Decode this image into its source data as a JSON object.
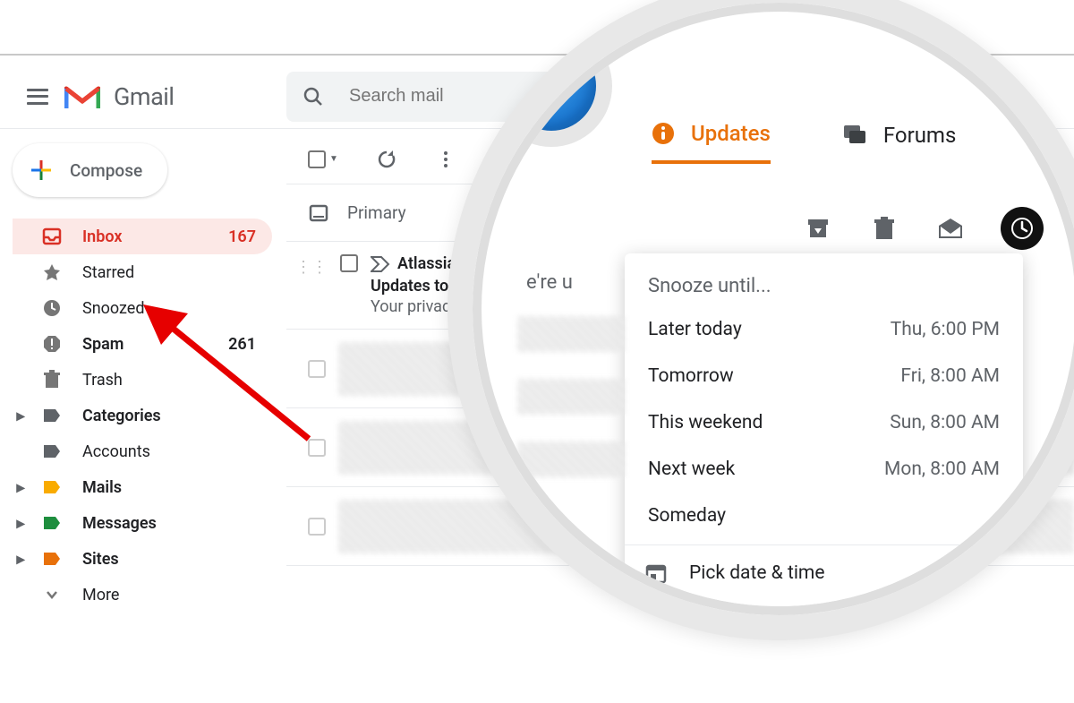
{
  "header": {
    "app_name": "Gmail",
    "search_placeholder": "Search mail"
  },
  "compose_label": "Compose",
  "sidebar": {
    "items": [
      {
        "label": "Inbox",
        "count": "167",
        "icon": "inbox",
        "active": true,
        "bold": true,
        "caret": false
      },
      {
        "label": "Starred",
        "count": "",
        "icon": "star",
        "active": false,
        "bold": false,
        "caret": false
      },
      {
        "label": "Snoozed",
        "count": "",
        "icon": "clock",
        "active": false,
        "bold": false,
        "caret": false
      },
      {
        "label": "Spam",
        "count": "261",
        "icon": "spam",
        "active": false,
        "bold": true,
        "caret": false
      },
      {
        "label": "Trash",
        "count": "",
        "icon": "trash",
        "active": false,
        "bold": false,
        "caret": false
      },
      {
        "label": "Categories",
        "count": "",
        "icon": "label-dark",
        "active": false,
        "bold": true,
        "caret": true
      },
      {
        "label": "Accounts",
        "count": "",
        "icon": "label-dark",
        "active": false,
        "bold": false,
        "caret": false
      },
      {
        "label": "Mails",
        "count": "",
        "icon": "label-orange",
        "active": false,
        "bold": true,
        "caret": true
      },
      {
        "label": "Messages",
        "count": "",
        "icon": "label-green",
        "active": false,
        "bold": true,
        "caret": true
      },
      {
        "label": "Sites",
        "count": "",
        "icon": "label-red",
        "active": false,
        "bold": true,
        "caret": true
      },
      {
        "label": "More",
        "count": "",
        "icon": "chevron",
        "active": false,
        "bold": false,
        "caret": false
      }
    ]
  },
  "tabs": {
    "primary": "Primary"
  },
  "email": {
    "sender": "Atlassian",
    "subject": "Updates to Atlass",
    "snippet": "Your privacy is im"
  },
  "magnifier": {
    "tab_updates": "Updates",
    "tab_forums": "Forums",
    "hint": "e're u",
    "popover": {
      "title": "Snooze until...",
      "options": [
        {
          "label": "Later today",
          "time": "Thu, 6:00 PM"
        },
        {
          "label": "Tomorrow",
          "time": "Fri, 8:00 AM"
        },
        {
          "label": "This weekend",
          "time": "Sun, 8:00 AM"
        },
        {
          "label": "Next week",
          "time": "Mon, 8:00 AM"
        },
        {
          "label": "Someday",
          "time": ""
        }
      ],
      "pick": "Pick date & time"
    }
  }
}
